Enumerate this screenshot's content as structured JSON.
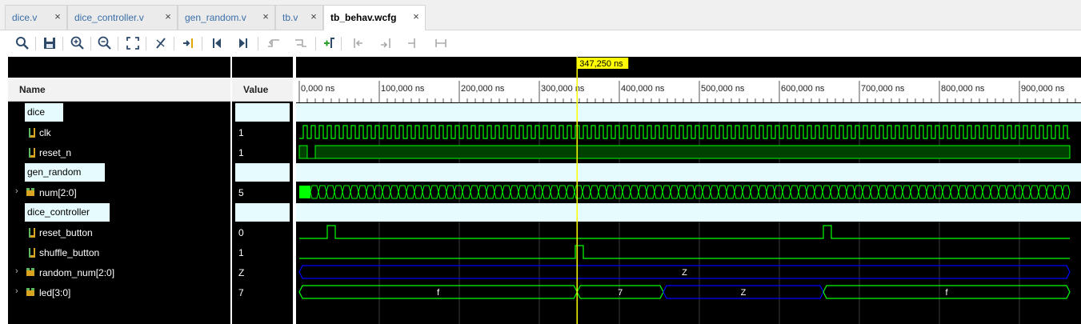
{
  "tabs": [
    {
      "label": "dice.v",
      "active": false
    },
    {
      "label": "dice_controller.v",
      "active": false
    },
    {
      "label": "gen_random.v",
      "active": false
    },
    {
      "label": "tb.v",
      "active": false
    },
    {
      "label": "tb_behav.wcfg",
      "active": true
    }
  ],
  "toolbar": {
    "icons": [
      "search-icon",
      "save-icon",
      "zoom-in-icon",
      "zoom-out-icon",
      "zoom-fit-icon",
      "marker-icon",
      "go-to-cursor-icon",
      "go-to-start-icon",
      "go-to-end-icon",
      "previous-transition-icon",
      "next-transition-icon",
      "add-marker-icon",
      "previous-marker-icon",
      "next-marker-icon",
      "swap-cursors-icon",
      "snap-to-transition-icon"
    ]
  },
  "colors": {
    "wave": "#00ff00",
    "bus_z": "#0000ff",
    "cursor": "#ffff00",
    "group_fill": "#e6fbfd"
  },
  "columns": {
    "name": "Name",
    "value": "Value"
  },
  "cursor": {
    "label": "347,250 ns",
    "time_ns": 347.25
  },
  "timeline": {
    "tick_labels": [
      "0,000 ns",
      "100,000 ns",
      "200,000 ns",
      "300,000 ns",
      "400,000 ns",
      "500,000 ns",
      "600,000 ns",
      "700,000 ns",
      "800,000 ns",
      "900,000 ns"
    ],
    "range_ns": [
      0,
      965
    ]
  },
  "signals": [
    {
      "kind": "group",
      "name": "dice"
    },
    {
      "kind": "bit",
      "name": "clk",
      "value": "1",
      "wave": "clock"
    },
    {
      "kind": "bit",
      "name": "reset_n",
      "value": "1",
      "wave": "reset_n"
    },
    {
      "kind": "group",
      "name": "gen_random"
    },
    {
      "kind": "bus",
      "name": "num[2:0]",
      "value": "5",
      "wave": "fastbus"
    },
    {
      "kind": "group",
      "name": "dice_controller"
    },
    {
      "kind": "bit",
      "name": "reset_button",
      "value": "0",
      "pulses_ns": [
        [
          35,
          45
        ],
        [
          655,
          665
        ]
      ]
    },
    {
      "kind": "bit",
      "name": "shuffle_button",
      "value": "1",
      "pulses_ns": [
        [
          345,
          355
        ]
      ]
    },
    {
      "kind": "bus",
      "name": "random_num[2:0]",
      "value": "Z",
      "segments": [
        {
          "from_ns": 0,
          "to_ns": 965,
          "label": "Z",
          "state": "z"
        }
      ]
    },
    {
      "kind": "bus",
      "name": "led[3:0]",
      "value": "7",
      "segments": [
        {
          "from_ns": 0,
          "to_ns": 347.25,
          "label": "f",
          "state": "v"
        },
        {
          "from_ns": 347.25,
          "to_ns": 455,
          "label": "7",
          "state": "v"
        },
        {
          "from_ns": 455,
          "to_ns": 655,
          "label": "Z",
          "state": "z"
        },
        {
          "from_ns": 655,
          "to_ns": 965,
          "label": "f",
          "state": "v"
        }
      ]
    }
  ]
}
